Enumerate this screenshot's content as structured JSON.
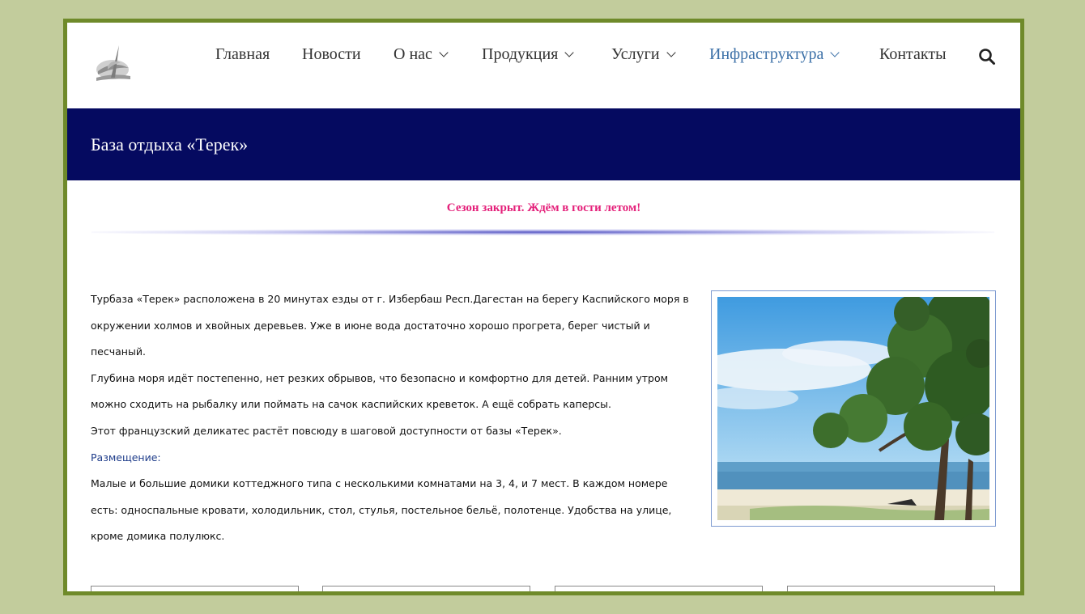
{
  "nav": {
    "items": [
      {
        "label": "Главная",
        "dropdown": false,
        "active": false
      },
      {
        "label": "Новости",
        "dropdown": false,
        "active": false
      },
      {
        "label": "О нас",
        "dropdown": true,
        "active": false
      },
      {
        "label": "Продукция",
        "dropdown": true,
        "active": false
      },
      {
        "label": "Услуги",
        "dropdown": true,
        "active": false
      },
      {
        "label": "Инфраструктура",
        "dropdown": true,
        "active": true
      },
      {
        "label": "Контакты",
        "dropdown": false,
        "active": false
      }
    ],
    "search_icon": "search-icon"
  },
  "page": {
    "title": "База отдыха «Терек»",
    "notice": "Сезон закрыт. Ждём в гости летом!"
  },
  "content": {
    "lines": [
      "Турбаза «Терек» расположена в 20 минутах езды от г. Избербаш Респ.Дагестан на берегу Каспийского моря в",
      "окружении холмов и хвойных деревьев. Уже в июне вода достаточно хорошо прогрета, берег чистый и",
      "песчаный.",
      "Глубина моря идёт постепенно, нет резких обрывов, что безопасно и комфортно для детей. Ранним утром",
      "можно сходить на рыбалку или поймать на сачок каспийских креветок.  А ещё собрать каперсы.",
      "Этот французский деликатес растёт повсюду в шаговой доступности от базы «Терек».",
      "Размещение:",
      "Малые и большие домики коттеджного типа с несколькими комнатами на 3, 4, и 7 мест. В каждом номере",
      "есть: односпальные кровати, холодильник, стол, стулья, постельное бельё, полотенце. Удобства на улице,",
      "кроме домика полулюкс."
    ]
  },
  "colors": {
    "band": "#050a60",
    "notice": "#e4207a",
    "active_nav": "#3d71a8",
    "frame_border": "#6f8a2a",
    "page_bg": "#c2cc9c"
  }
}
